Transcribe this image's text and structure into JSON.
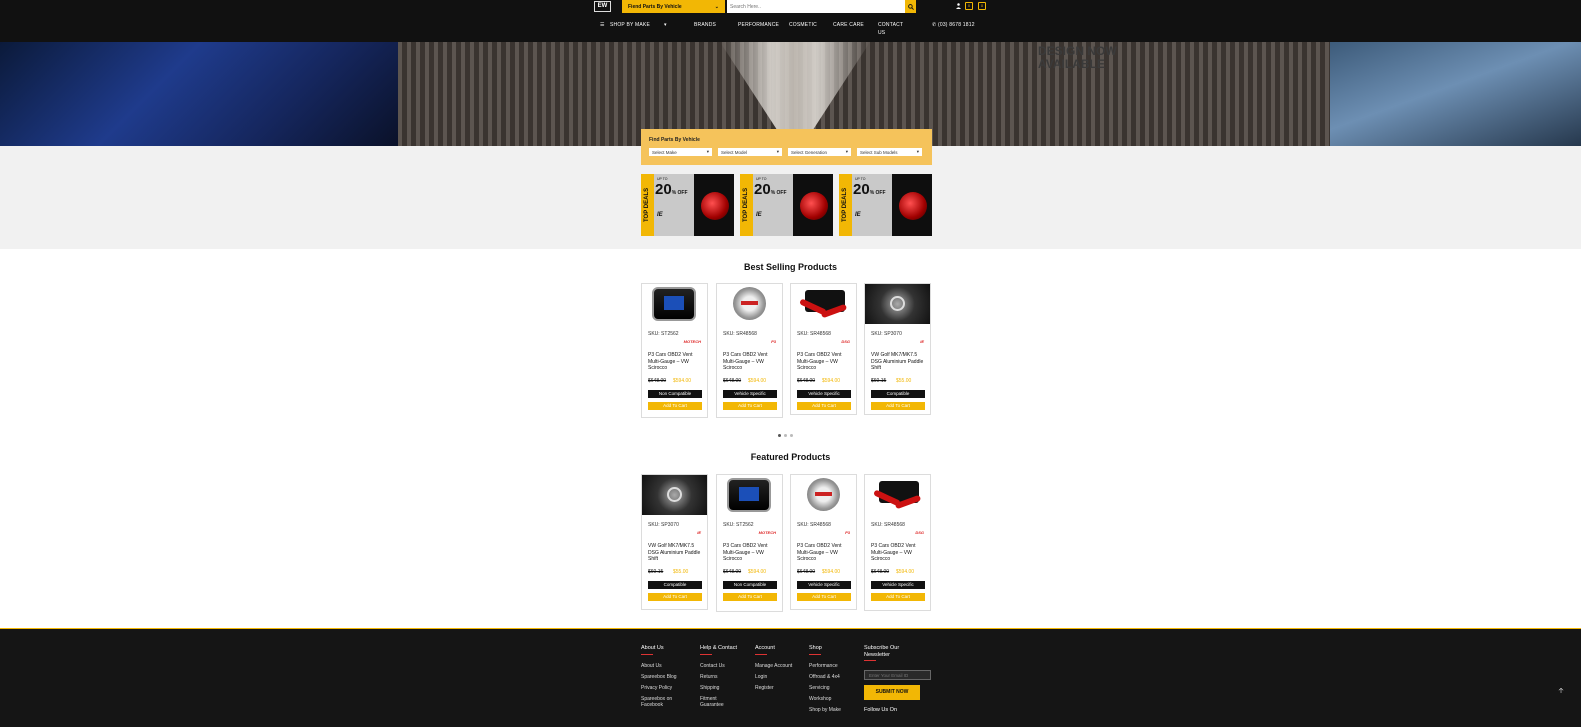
{
  "header": {
    "logo": "EW",
    "find_parts": "Fiend Parts By Vehicle",
    "search_placeholder": "Search Here..",
    "phone": "(03) 8678 1812",
    "bag_count": "0",
    "cart_count": "0"
  },
  "nav": {
    "shop_by_make": "SHOP BY MAKE",
    "brands": "BRANDS",
    "performance": "PERFORMANCE",
    "cosmetic": "COSMETIC",
    "care_care": "CARE CARE",
    "contact": "CONTACT",
    "contact_us": "US"
  },
  "hero": {
    "line1": "DESIGN NOW",
    "line2": "AVAILABLE"
  },
  "finder": {
    "title": "Find Parts By Vehicle",
    "make": "Select Make",
    "model": "Select Model",
    "generation": "Select Generation",
    "sub_models": "Select Sub Models"
  },
  "deals": [
    {
      "strip": "TOP DEALS",
      "upto": "UP TO",
      "pct": "20",
      "off": "% OFF",
      "brand": "IE"
    },
    {
      "strip": "TOP DEALS",
      "upto": "UP TO",
      "pct": "20",
      "off": "% OFF",
      "brand": "IE"
    },
    {
      "strip": "TOP DEALS",
      "upto": "UP TO",
      "pct": "20",
      "off": "% OFF",
      "brand": "IE"
    }
  ],
  "best_selling": {
    "title": "Best Selling Products",
    "items": [
      {
        "sku": "SKU: ST2562",
        "brand": "MOTECH",
        "title": "P3 Cars OBD2 Vent Multi-Gauge – VW Scirocco",
        "old": "$648.00",
        "price": "$594.00",
        "tag": "Non Compatible",
        "cart": "Add To Cart"
      },
      {
        "sku": "SKU: SR48568",
        "brand": "P3",
        "title": "P3 Cars OBD2 Vent Multi-Gauge – VW Scirocco",
        "old": "$648.00",
        "price": "$594.00",
        "tag": "Vehicle Specific",
        "cart": "Add To Cart"
      },
      {
        "sku": "SKU: SR48568",
        "brand": "DSG",
        "title": "P3 Cars OBD2 Vent Multi-Gauge – VW Scirocco",
        "old": "$648.00",
        "price": "$594.00",
        "tag": "Vehicle Specific",
        "cart": "Add To Cart"
      },
      {
        "sku": "SKU: SP3070",
        "brand": "IE",
        "title": "VW Golf MK7/MK7.5 DSG Aluminium Paddle Shift",
        "old": "$60.15",
        "price": "$55.00",
        "tag": "Compatible",
        "cart": "Add To Cart"
      }
    ]
  },
  "featured": {
    "title": "Featured Products",
    "items": [
      {
        "sku": "SKU: SP3070",
        "brand": "IE",
        "title": "VW Golf MK7/MK7.5 DSG Aluminium Paddle Shift",
        "old": "$60.15",
        "price": "$55.00",
        "tag": "Compatible",
        "cart": "Add To Cart"
      },
      {
        "sku": "SKU: ST2562",
        "brand": "MOTECH",
        "title": "P3 Cars OBD2 Vent Multi-Gauge – VW Scirocco",
        "old": "$648.00",
        "price": "$594.00",
        "tag": "Non Compatible",
        "cart": "Add To Cart"
      },
      {
        "sku": "SKU: SR48568",
        "brand": "P3",
        "title": "P3 Cars OBD2 Vent Multi-Gauge – VW Scirocco",
        "old": "$648.00",
        "price": "$594.00",
        "tag": "Vehicle Specific",
        "cart": "Add To Cart"
      },
      {
        "sku": "SKU: SR48568",
        "brand": "DSG",
        "title": "P3 Cars OBD2 Vent Multi-Gauge – VW Scirocco",
        "old": "$648.00",
        "price": "$594.00",
        "tag": "Vehicle Specific",
        "cart": "Add To Cart"
      }
    ]
  },
  "footer": {
    "about": {
      "head": "About Us",
      "links": [
        "About Us",
        "Spareebox Blog",
        "Privacy Policy",
        "Spareebox on Facebook"
      ]
    },
    "help": {
      "head": "Help & Contact",
      "links": [
        "Contact Us",
        "Returns",
        "Shipping",
        "Fitment Guarantee"
      ]
    },
    "account": {
      "head": "Account",
      "links": [
        "Manage Account",
        "Login",
        "Register"
      ]
    },
    "shop": {
      "head": "Shop",
      "links": [
        "Performance",
        "Offroad & 4x4",
        "Servicing",
        "Workshop",
        "Shop by Make"
      ]
    },
    "newsletter": {
      "head": "Subscribe Our Newsletter",
      "placeholder": "Enter Your Email ID",
      "submit": "SUBMIT NOW",
      "follow": "Follow Us On"
    }
  },
  "colors": {
    "accent": "#f2b705",
    "dark": "#111111",
    "footer": "#151515"
  }
}
